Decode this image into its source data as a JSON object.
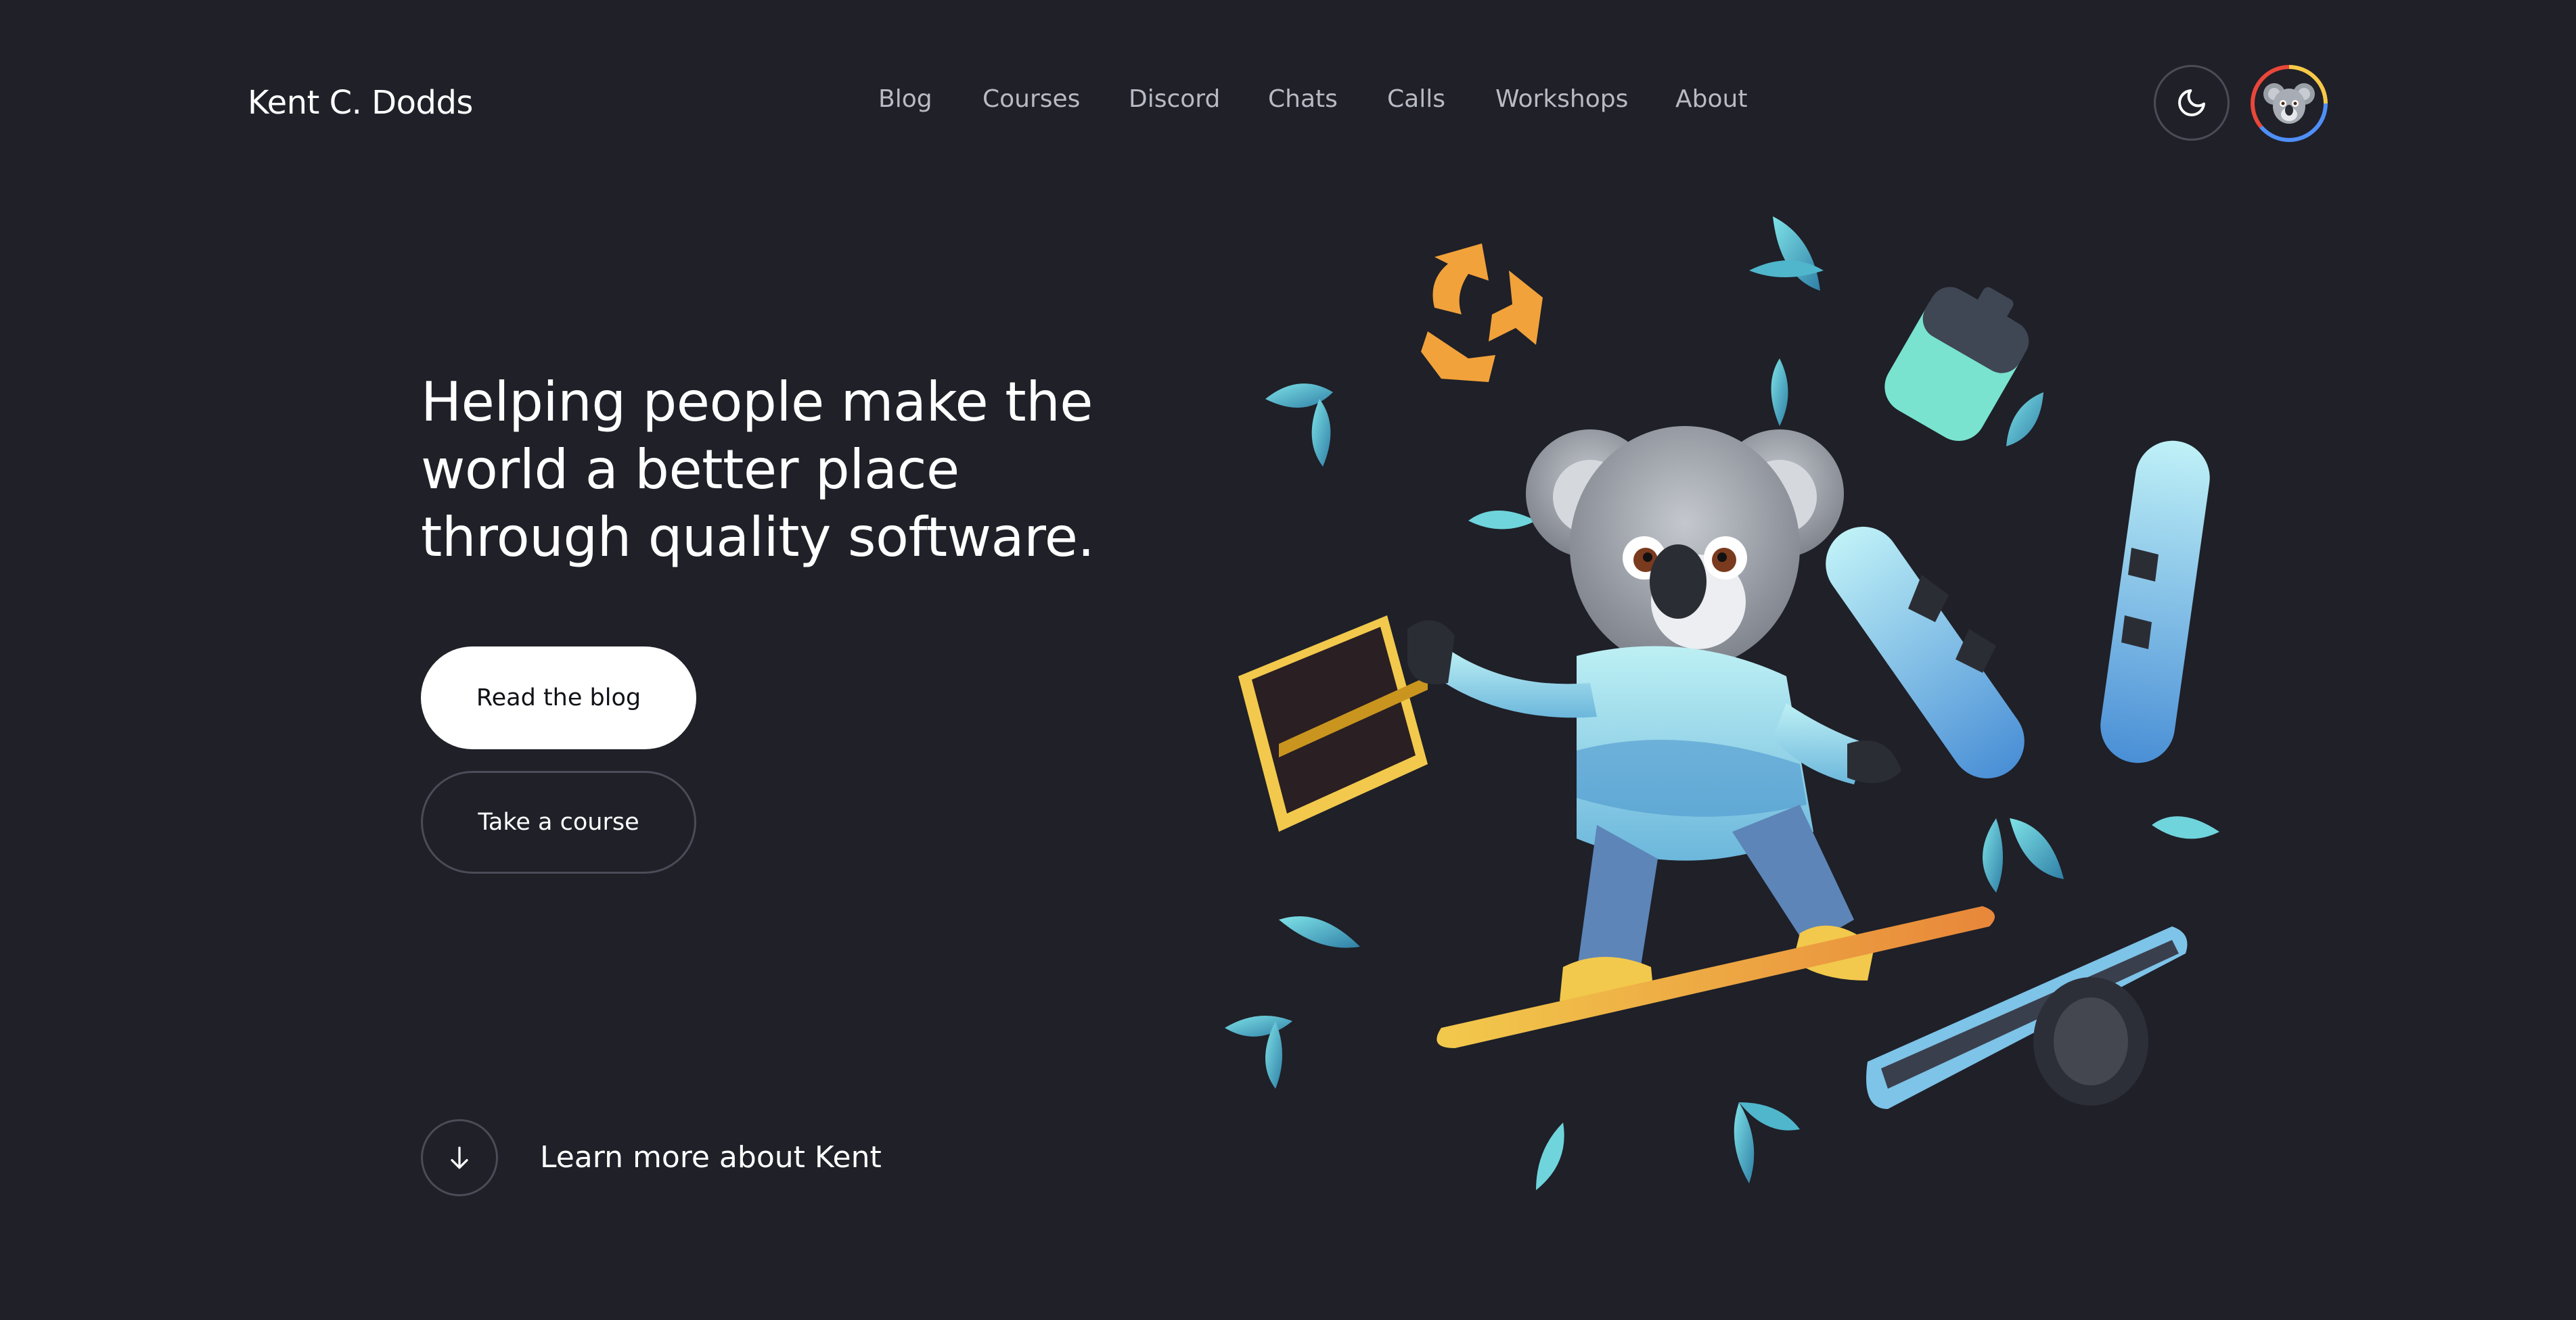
{
  "header": {
    "logo": "Kent C. Dodds",
    "nav": [
      "Blog",
      "Courses",
      "Discord",
      "Chats",
      "Calls",
      "Workshops",
      "About"
    ],
    "theme_icon": "moon-icon",
    "avatar_icon": "koala-avatar"
  },
  "hero": {
    "title": "Helping people make the world a better place through quality software.",
    "primary_button": "Read the blog",
    "secondary_button": "Take a course",
    "learn_more": "Learn more about Kent",
    "learn_icon": "arrow-down-icon"
  },
  "colors": {
    "background": "#1f2028",
    "text": "#ffffff",
    "muted": "#b8bac4",
    "border": "#4a4c57",
    "accent_teal": "#5cc8d6",
    "accent_yellow": "#f2c94c",
    "accent_orange": "#f2994a"
  }
}
